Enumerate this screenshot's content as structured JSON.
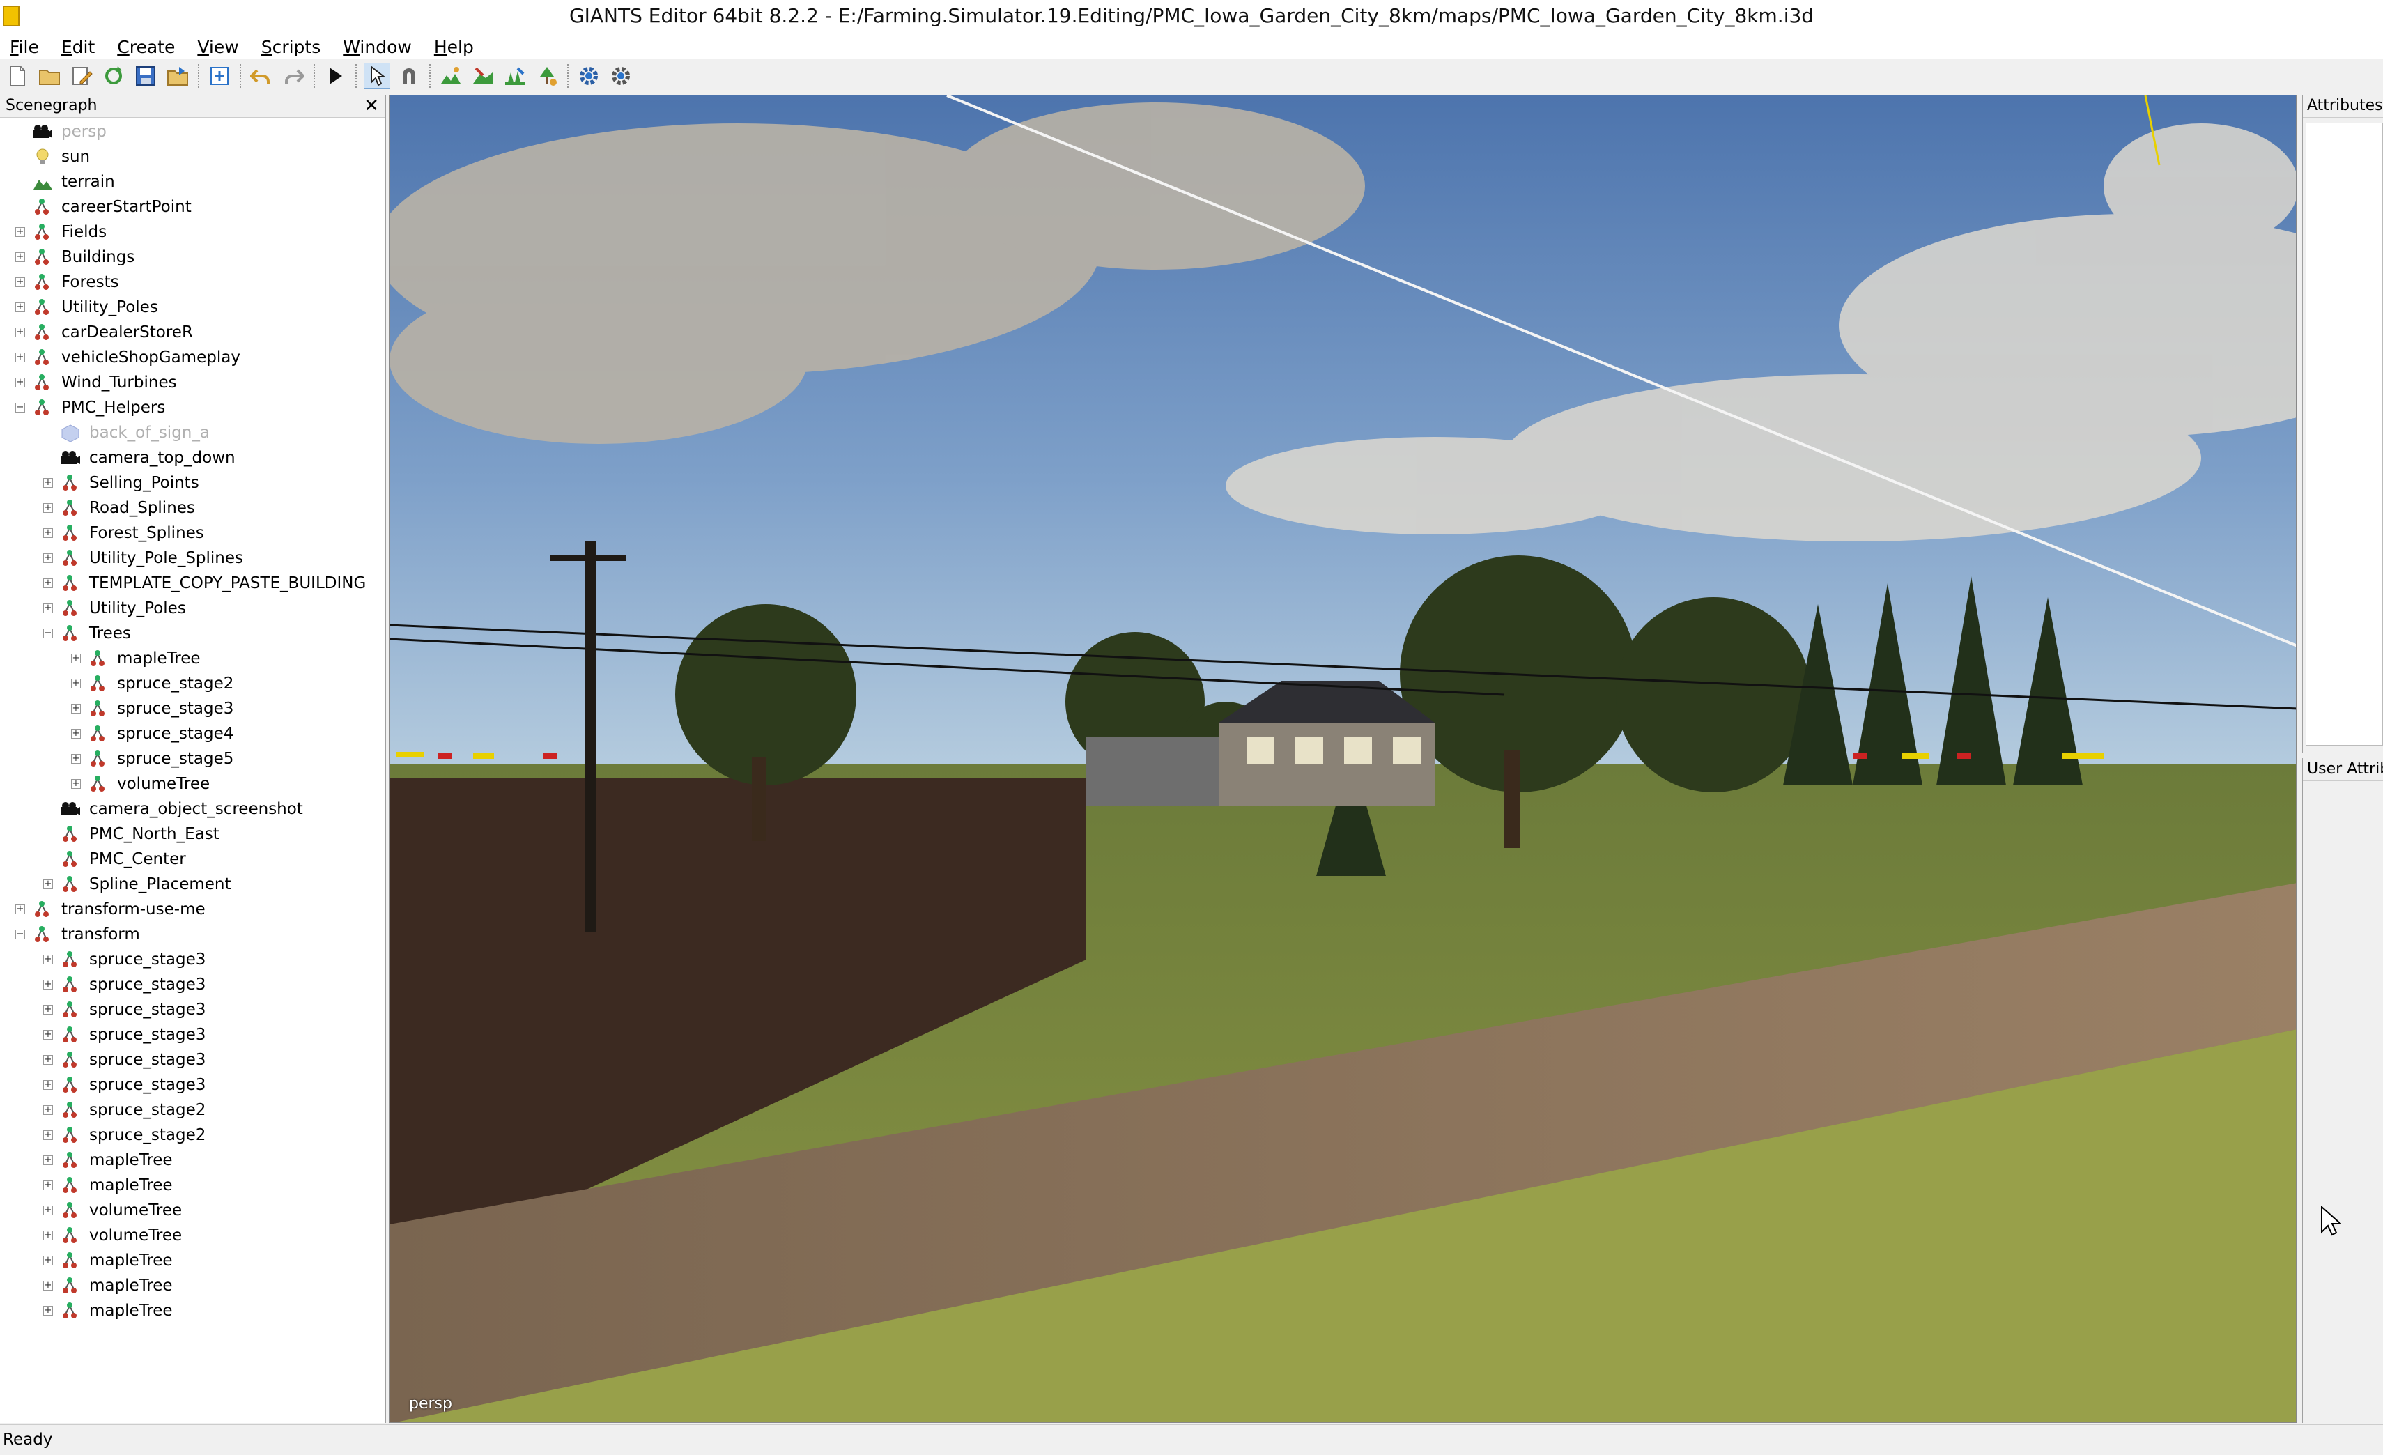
{
  "window": {
    "title": "GIANTS Editor 64bit 8.2.2 - E:/Farming.Simulator.19.Editing/PMC_Iowa_Garden_City_8km/maps/PMC_Iowa_Garden_City_8km.i3d"
  },
  "menu": [
    "File",
    "Edit",
    "Create",
    "View",
    "Scripts",
    "Window",
    "Help"
  ],
  "scenegraph": {
    "title": "Scenegraph",
    "close": "✕",
    "nodes": [
      {
        "label": "persp",
        "depth": 0,
        "expander": "none",
        "icon": "camera-icon",
        "dim": true
      },
      {
        "label": "sun",
        "depth": 0,
        "expander": "none",
        "icon": "light-icon"
      },
      {
        "label": "terrain",
        "depth": 0,
        "expander": "none",
        "icon": "terrain-icon"
      },
      {
        "label": "careerStartPoint",
        "depth": 0,
        "expander": "none",
        "icon": "transform-group-icon"
      },
      {
        "label": "Fields",
        "depth": 0,
        "expander": "plus",
        "icon": "transform-group-icon"
      },
      {
        "label": "Buildings",
        "depth": 0,
        "expander": "plus",
        "icon": "transform-group-icon"
      },
      {
        "label": "Forests",
        "depth": 0,
        "expander": "plus",
        "icon": "transform-group-icon"
      },
      {
        "label": "Utility_Poles",
        "depth": 0,
        "expander": "plus",
        "icon": "transform-group-icon"
      },
      {
        "label": "carDealerStoreR",
        "depth": 0,
        "expander": "plus",
        "icon": "transform-group-icon"
      },
      {
        "label": "vehicleShopGameplay",
        "depth": 0,
        "expander": "plus",
        "icon": "transform-group-icon"
      },
      {
        "label": "Wind_Turbines",
        "depth": 0,
        "expander": "plus",
        "icon": "transform-group-icon"
      },
      {
        "label": "PMC_Helpers",
        "depth": 0,
        "expander": "minus",
        "icon": "transform-group-icon"
      },
      {
        "label": "back_of_sign_a",
        "depth": 1,
        "expander": "none",
        "icon": "shape-icon",
        "dim": true
      },
      {
        "label": "camera_top_down",
        "depth": 1,
        "expander": "none",
        "icon": "camera-icon"
      },
      {
        "label": "Selling_Points",
        "depth": 1,
        "expander": "plus",
        "icon": "transform-group-icon"
      },
      {
        "label": "Road_Splines",
        "depth": 1,
        "expander": "plus",
        "icon": "transform-group-icon"
      },
      {
        "label": "Forest_Splines",
        "depth": 1,
        "expander": "plus",
        "icon": "transform-group-icon"
      },
      {
        "label": "Utility_Pole_Splines",
        "depth": 1,
        "expander": "plus",
        "icon": "transform-group-icon"
      },
      {
        "label": "TEMPLATE_COPY_PASTE_BUILDING",
        "depth": 1,
        "expander": "plus",
        "icon": "transform-group-icon"
      },
      {
        "label": "Utility_Poles",
        "depth": 1,
        "expander": "plus",
        "icon": "transform-group-icon"
      },
      {
        "label": "Trees",
        "depth": 1,
        "expander": "minus",
        "icon": "transform-group-icon"
      },
      {
        "label": "mapleTree",
        "depth": 2,
        "expander": "plus",
        "icon": "transform-group-icon"
      },
      {
        "label": "spruce_stage2",
        "depth": 2,
        "expander": "plus",
        "icon": "transform-group-icon"
      },
      {
        "label": "spruce_stage3",
        "depth": 2,
        "expander": "plus",
        "icon": "transform-group-icon"
      },
      {
        "label": "spruce_stage4",
        "depth": 2,
        "expander": "plus",
        "icon": "transform-group-icon"
      },
      {
        "label": "spruce_stage5",
        "depth": 2,
        "expander": "plus",
        "icon": "transform-group-icon"
      },
      {
        "label": "volumeTree",
        "depth": 2,
        "expander": "plus",
        "icon": "transform-group-icon"
      },
      {
        "label": "camera_object_screenshot",
        "depth": 1,
        "expander": "none",
        "icon": "camera-icon"
      },
      {
        "label": "PMC_North_East",
        "depth": 1,
        "expander": "none",
        "icon": "transform-group-icon"
      },
      {
        "label": "PMC_Center",
        "depth": 1,
        "expander": "none",
        "icon": "transform-group-icon"
      },
      {
        "label": "Spline_Placement",
        "depth": 1,
        "expander": "plus",
        "icon": "transform-group-icon"
      },
      {
        "label": "transform-use-me",
        "depth": 0,
        "expander": "plus",
        "icon": "transform-group-icon"
      },
      {
        "label": "transform",
        "depth": 0,
        "expander": "minus",
        "icon": "transform-group-icon"
      },
      {
        "label": "spruce_stage3",
        "depth": 1,
        "expander": "plus",
        "icon": "transform-group-icon"
      },
      {
        "label": "spruce_stage3",
        "depth": 1,
        "expander": "plus",
        "icon": "transform-group-icon"
      },
      {
        "label": "spruce_stage3",
        "depth": 1,
        "expander": "plus",
        "icon": "transform-group-icon"
      },
      {
        "label": "spruce_stage3",
        "depth": 1,
        "expander": "plus",
        "icon": "transform-group-icon"
      },
      {
        "label": "spruce_stage3",
        "depth": 1,
        "expander": "plus",
        "icon": "transform-group-icon"
      },
      {
        "label": "spruce_stage3",
        "depth": 1,
        "expander": "plus",
        "icon": "transform-group-icon"
      },
      {
        "label": "spruce_stage2",
        "depth": 1,
        "expander": "plus",
        "icon": "transform-group-icon"
      },
      {
        "label": "spruce_stage2",
        "depth": 1,
        "expander": "plus",
        "icon": "transform-group-icon"
      },
      {
        "label": "mapleTree",
        "depth": 1,
        "expander": "plus",
        "icon": "transform-group-icon"
      },
      {
        "label": "mapleTree",
        "depth": 1,
        "expander": "plus",
        "icon": "transform-group-icon"
      },
      {
        "label": "volumeTree",
        "depth": 1,
        "expander": "plus",
        "icon": "transform-group-icon"
      },
      {
        "label": "volumeTree",
        "depth": 1,
        "expander": "plus",
        "icon": "transform-group-icon"
      },
      {
        "label": "mapleTree",
        "depth": 1,
        "expander": "plus",
        "icon": "transform-group-icon"
      },
      {
        "label": "mapleTree",
        "depth": 1,
        "expander": "plus",
        "icon": "transform-group-icon"
      },
      {
        "label": "mapleTree",
        "depth": 1,
        "expander": "plus",
        "icon": "transform-group-icon"
      }
    ]
  },
  "viewport": {
    "camera_label": "persp"
  },
  "attributes": {
    "title": "Attributes"
  },
  "user_attributes": {
    "title": "User Attributes"
  },
  "status": {
    "text": "Ready"
  },
  "colors": {
    "accent": "#2b73c9",
    "tree_dim": "#b0b0b0",
    "node_red": "#c0392b",
    "node_green": "#27ae60"
  }
}
